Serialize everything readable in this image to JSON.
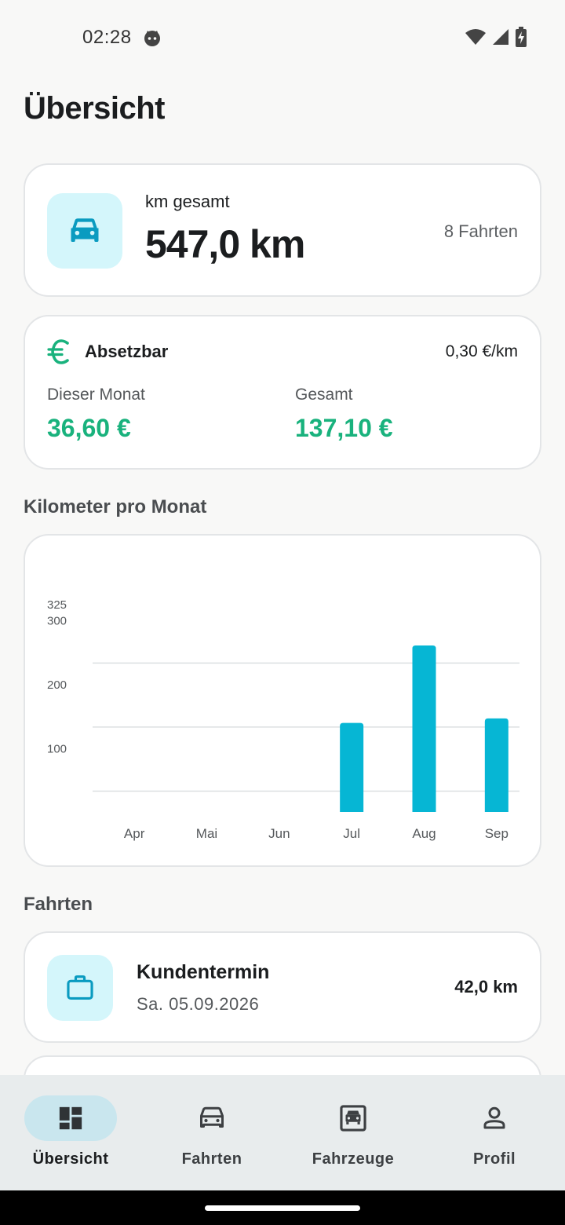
{
  "status_bar": {
    "time": "02:28"
  },
  "page": {
    "title": "Übersicht"
  },
  "km_summary": {
    "label": "km gesamt",
    "value": "547,0 km",
    "trips": "8 Fahrten",
    "icon": "car-icon"
  },
  "deductible": {
    "title": "Absetzbar",
    "rate": "0,30 €/km",
    "month_label": "Dieser Monat",
    "month_value": "36,60 €",
    "total_label": "Gesamt",
    "total_value": "137,10 €",
    "icon": "euro-icon"
  },
  "chart_section": {
    "heading": "Kilometer pro Monat"
  },
  "chart_data": {
    "type": "bar",
    "categories": [
      "Apr",
      "Mai",
      "Jun",
      "Jul",
      "Aug",
      "Sep"
    ],
    "values": [
      0,
      0,
      0,
      139,
      260,
      146
    ],
    "ylim": [
      0,
      325
    ],
    "yticks": [
      100,
      200,
      300,
      325
    ],
    "grid": true,
    "bar_color": "#06b6d4"
  },
  "trips_section": {
    "heading": "Fahrten",
    "items": [
      {
        "title": "Kundentermin",
        "date": "Sa. 05.09.2026",
        "km": "42,0 km",
        "icon": "briefcase-icon"
      }
    ]
  },
  "bottom_nav": {
    "items": [
      {
        "label": "Übersicht",
        "icon": "dashboard-icon",
        "active": true
      },
      {
        "label": "Fahrten",
        "icon": "car-icon",
        "active": false
      },
      {
        "label": "Fahrzeuge",
        "icon": "vehicle-icon",
        "active": false
      },
      {
        "label": "Profil",
        "icon": "person-icon",
        "active": false
      }
    ]
  },
  "colors": {
    "accent": "#06b6d4",
    "accent_light": "#d4f6fb",
    "money_green": "#19b27d",
    "nav_active": "#c9e6ee"
  }
}
